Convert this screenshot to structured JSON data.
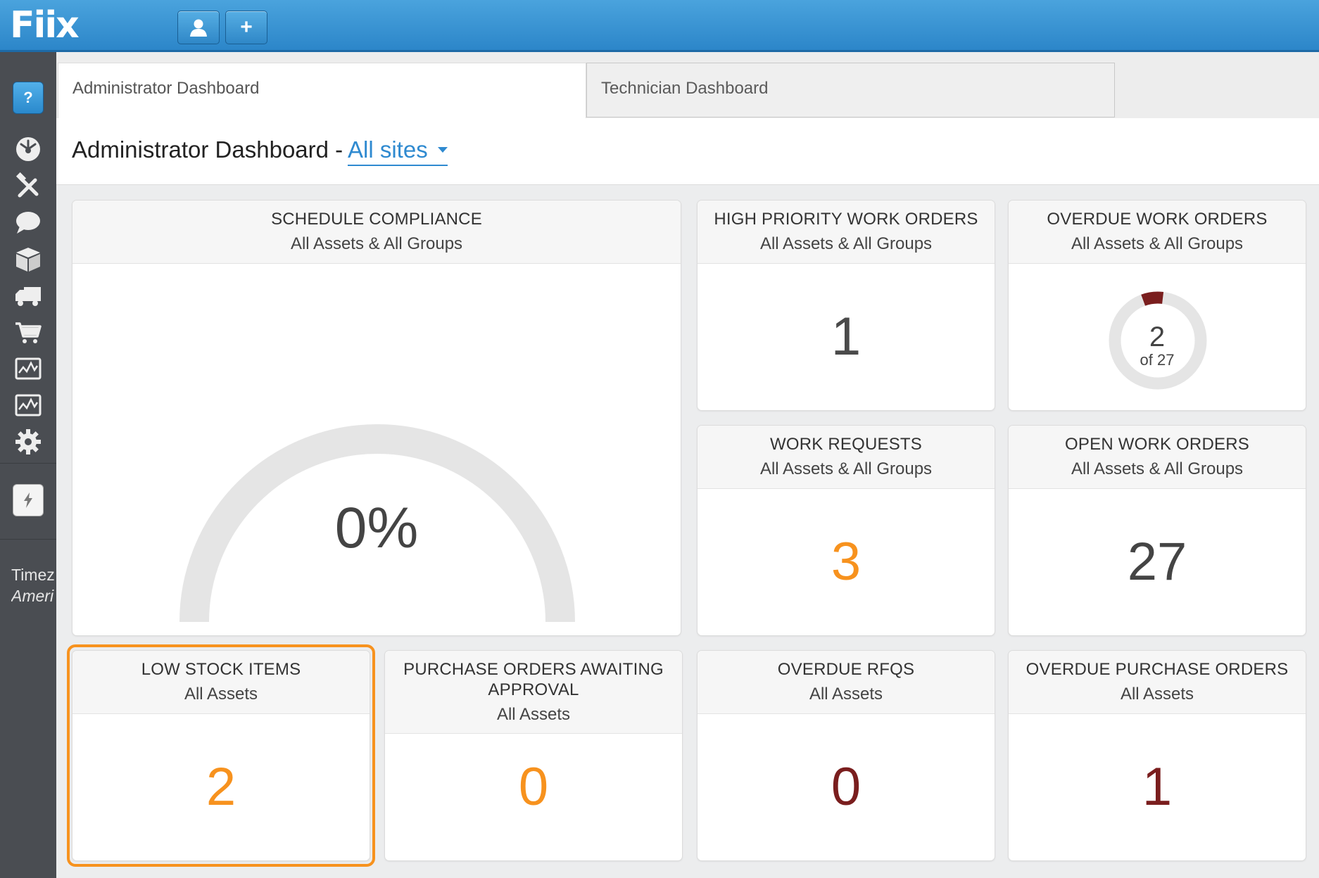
{
  "app": {
    "logo": "Fiix"
  },
  "topbar": {
    "user_icon": "user-icon",
    "add_label": "+"
  },
  "sidebar": {
    "help_label": "?",
    "items": [
      "dashboard-icon",
      "tools-icon",
      "chat-icon",
      "box-icon",
      "truck-icon",
      "cart-icon",
      "report-icon",
      "report-alt-icon",
      "gear-icon"
    ],
    "timezone_label": "Timez",
    "timezone_value": "Ameri"
  },
  "tabs": [
    {
      "label": "Administrator Dashboard",
      "active": true
    },
    {
      "label": "Technician Dashboard",
      "active": false
    }
  ],
  "header": {
    "title": "Administrator Dashboard -",
    "site": "All sites"
  },
  "widgets": {
    "schedule": {
      "title": "SCHEDULE COMPLIANCE",
      "sub": "All Assets & All Groups",
      "value": "0%",
      "percent": 0
    },
    "high_priority": {
      "title": "HIGH PRIORITY WORK ORDERS",
      "sub": "All Assets & All Groups",
      "value": "1"
    },
    "overdue_wo": {
      "title": "OVERDUE WORK ORDERS",
      "sub": "All Assets & All Groups",
      "value": "2",
      "of_label": "of 27",
      "count": 2,
      "total": 27
    },
    "work_requests": {
      "title": "WORK REQUESTS",
      "sub": "All Assets & All Groups",
      "value": "3"
    },
    "open_wo": {
      "title": "OPEN WORK ORDERS",
      "sub": "All Assets & All Groups",
      "value": "27"
    },
    "low_stock": {
      "title": "LOW STOCK ITEMS",
      "sub": "All Assets",
      "value": "2"
    },
    "po_awaiting": {
      "title": "PURCHASE ORDERS AWAITING",
      "title2": "APPROVAL",
      "sub": "All Assets",
      "value": "0"
    },
    "overdue_rfq": {
      "title": "OVERDUE RFQS",
      "sub": "All Assets",
      "value": "0"
    },
    "overdue_po": {
      "title": "OVERDUE PURCHASE ORDERS",
      "sub": "All Assets",
      "value": "1"
    }
  },
  "colors": {
    "orange": "#f7921e",
    "maroon": "#7a1e1e",
    "dark": "#4a4a4a",
    "accent": "#2f8ad0"
  }
}
